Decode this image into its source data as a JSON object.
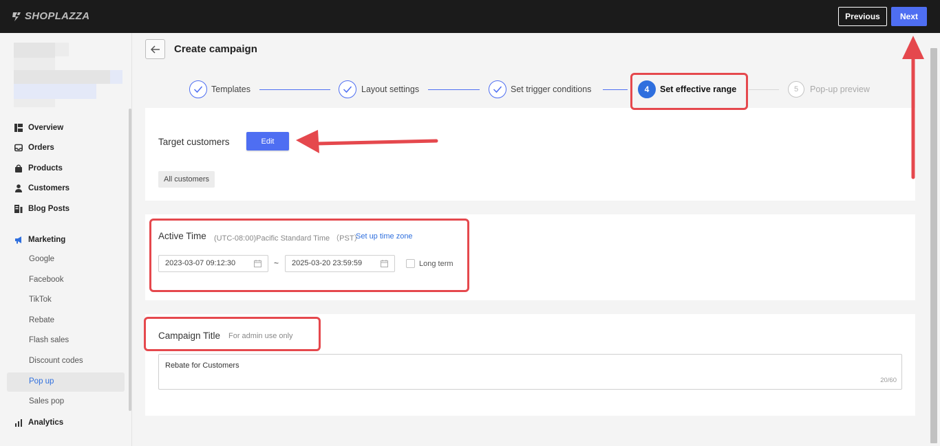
{
  "topbar": {
    "logo_text": "SHOPLAZZA",
    "previous_label": "Previous",
    "next_label": "Next"
  },
  "sidebar": {
    "items": [
      {
        "label": "Overview",
        "icon": "overview-icon"
      },
      {
        "label": "Orders",
        "icon": "inbox-icon"
      },
      {
        "label": "Products",
        "icon": "bag-icon"
      },
      {
        "label": "Customers",
        "icon": "person-icon"
      },
      {
        "label": "Blog Posts",
        "icon": "blog-icon"
      },
      {
        "label": "Marketing",
        "icon": "megaphone-icon"
      },
      {
        "label": "Analytics",
        "icon": "bar-chart-icon"
      }
    ],
    "marketing_sub": [
      "Google",
      "Facebook",
      "TikTok",
      "Rebate",
      "Flash sales",
      "Discount codes",
      "Pop up",
      "Sales pop"
    ],
    "active_sub": "Pop up"
  },
  "header": {
    "title": "Create campaign"
  },
  "steps": [
    {
      "number": "1",
      "label": "Templates",
      "state": "done"
    },
    {
      "number": "2",
      "label": "Layout settings",
      "state": "done"
    },
    {
      "number": "3",
      "label": "Set trigger conditions",
      "state": "done"
    },
    {
      "number": "4",
      "label": "Set effective range",
      "state": "active"
    },
    {
      "number": "5",
      "label": "Pop-up preview",
      "state": "todo"
    }
  ],
  "target": {
    "label": "Target customers",
    "edit_label": "Edit",
    "tag": "All customers"
  },
  "active_time": {
    "label": "Active Time",
    "timezone": "(UTC-08:00)Pacific Standard Time （PST）",
    "setup_link": "Set up time zone",
    "start": "2023-03-07 09:12:30",
    "separator": "~",
    "end": "2025-03-20 23:59:59",
    "long_term_label": "Long term",
    "long_term_checked": false
  },
  "campaign_title": {
    "label": "Campaign Title",
    "hint": "For admin use only",
    "value": "Rebate for Customers",
    "count": "20/60"
  },
  "colors": {
    "accent": "#4e6ef2",
    "highlight": "#e5484d",
    "topbar": "#1b1b1b"
  }
}
